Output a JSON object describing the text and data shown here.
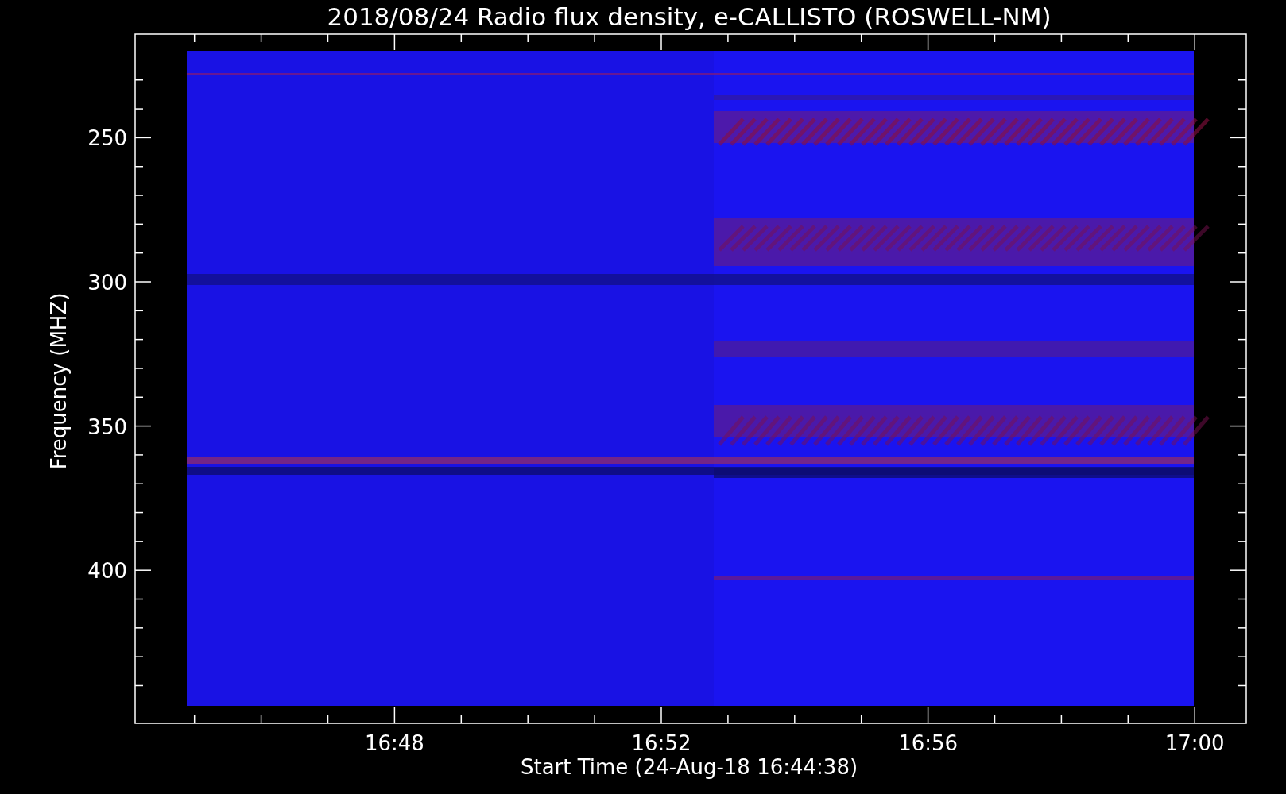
{
  "plot": {
    "title": "2018/08/24  Radio flux density, e-CALLISTO (ROSWELL-NM)",
    "ylabel": "Frequency (MHZ)",
    "xlabel": "Start Time (24-Aug-18 16:44:38)",
    "yticks": [
      "250",
      "300",
      "350",
      "400"
    ],
    "xticks": [
      "16:48",
      "16:52",
      "16:56",
      "17:00"
    ]
  }
}
